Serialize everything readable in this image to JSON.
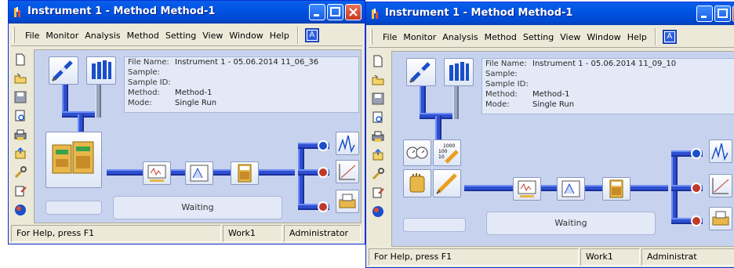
{
  "windows": [
    {
      "title": "Instrument 1 - Method  Method-1",
      "menu": {
        "file": "File",
        "monitor": "Monitor",
        "analysis": "Analysis",
        "method": "Method",
        "setting": "Setting",
        "view": "View",
        "window": "Window",
        "help": "Help"
      },
      "info": {
        "file_name_label": "File Name:",
        "file_name": "Instrument 1 - 05.06.2014 11_06_36",
        "sample_label": "Sample:",
        "sample": "",
        "sample_id_label": "Sample ID:",
        "sample_id": "",
        "method_label": "Method:",
        "method": "Method-1",
        "mode_label": "Mode:",
        "mode": "Single Run"
      },
      "status_text": "Waiting",
      "statusbar": {
        "help": "For Help, press F1",
        "work": "Work1",
        "user": "Administrator"
      }
    },
    {
      "title": "Instrument 1 - Method  Method-1",
      "menu": {
        "file": "File",
        "monitor": "Monitor",
        "analysis": "Analysis",
        "method": "Method",
        "setting": "Setting",
        "view": "View",
        "window": "Window",
        "help": "Help"
      },
      "info": {
        "file_name_label": "File Name:",
        "file_name": "Instrument 1 - 05.06.2014 11_09_10",
        "sample_label": "Sample:",
        "sample": "",
        "sample_id_label": "Sample ID:",
        "sample_id": "",
        "method_label": "Method:",
        "method": "Method-1",
        "mode_label": "Mode:",
        "mode": "Single Run"
      },
      "status_text": "Waiting",
      "statusbar": {
        "help": "For Help, press F1",
        "work": "Work1",
        "user": "Administrat"
      }
    }
  ],
  "icons": {
    "help_icon": "A",
    "counter_icon": "1000 100 10"
  }
}
